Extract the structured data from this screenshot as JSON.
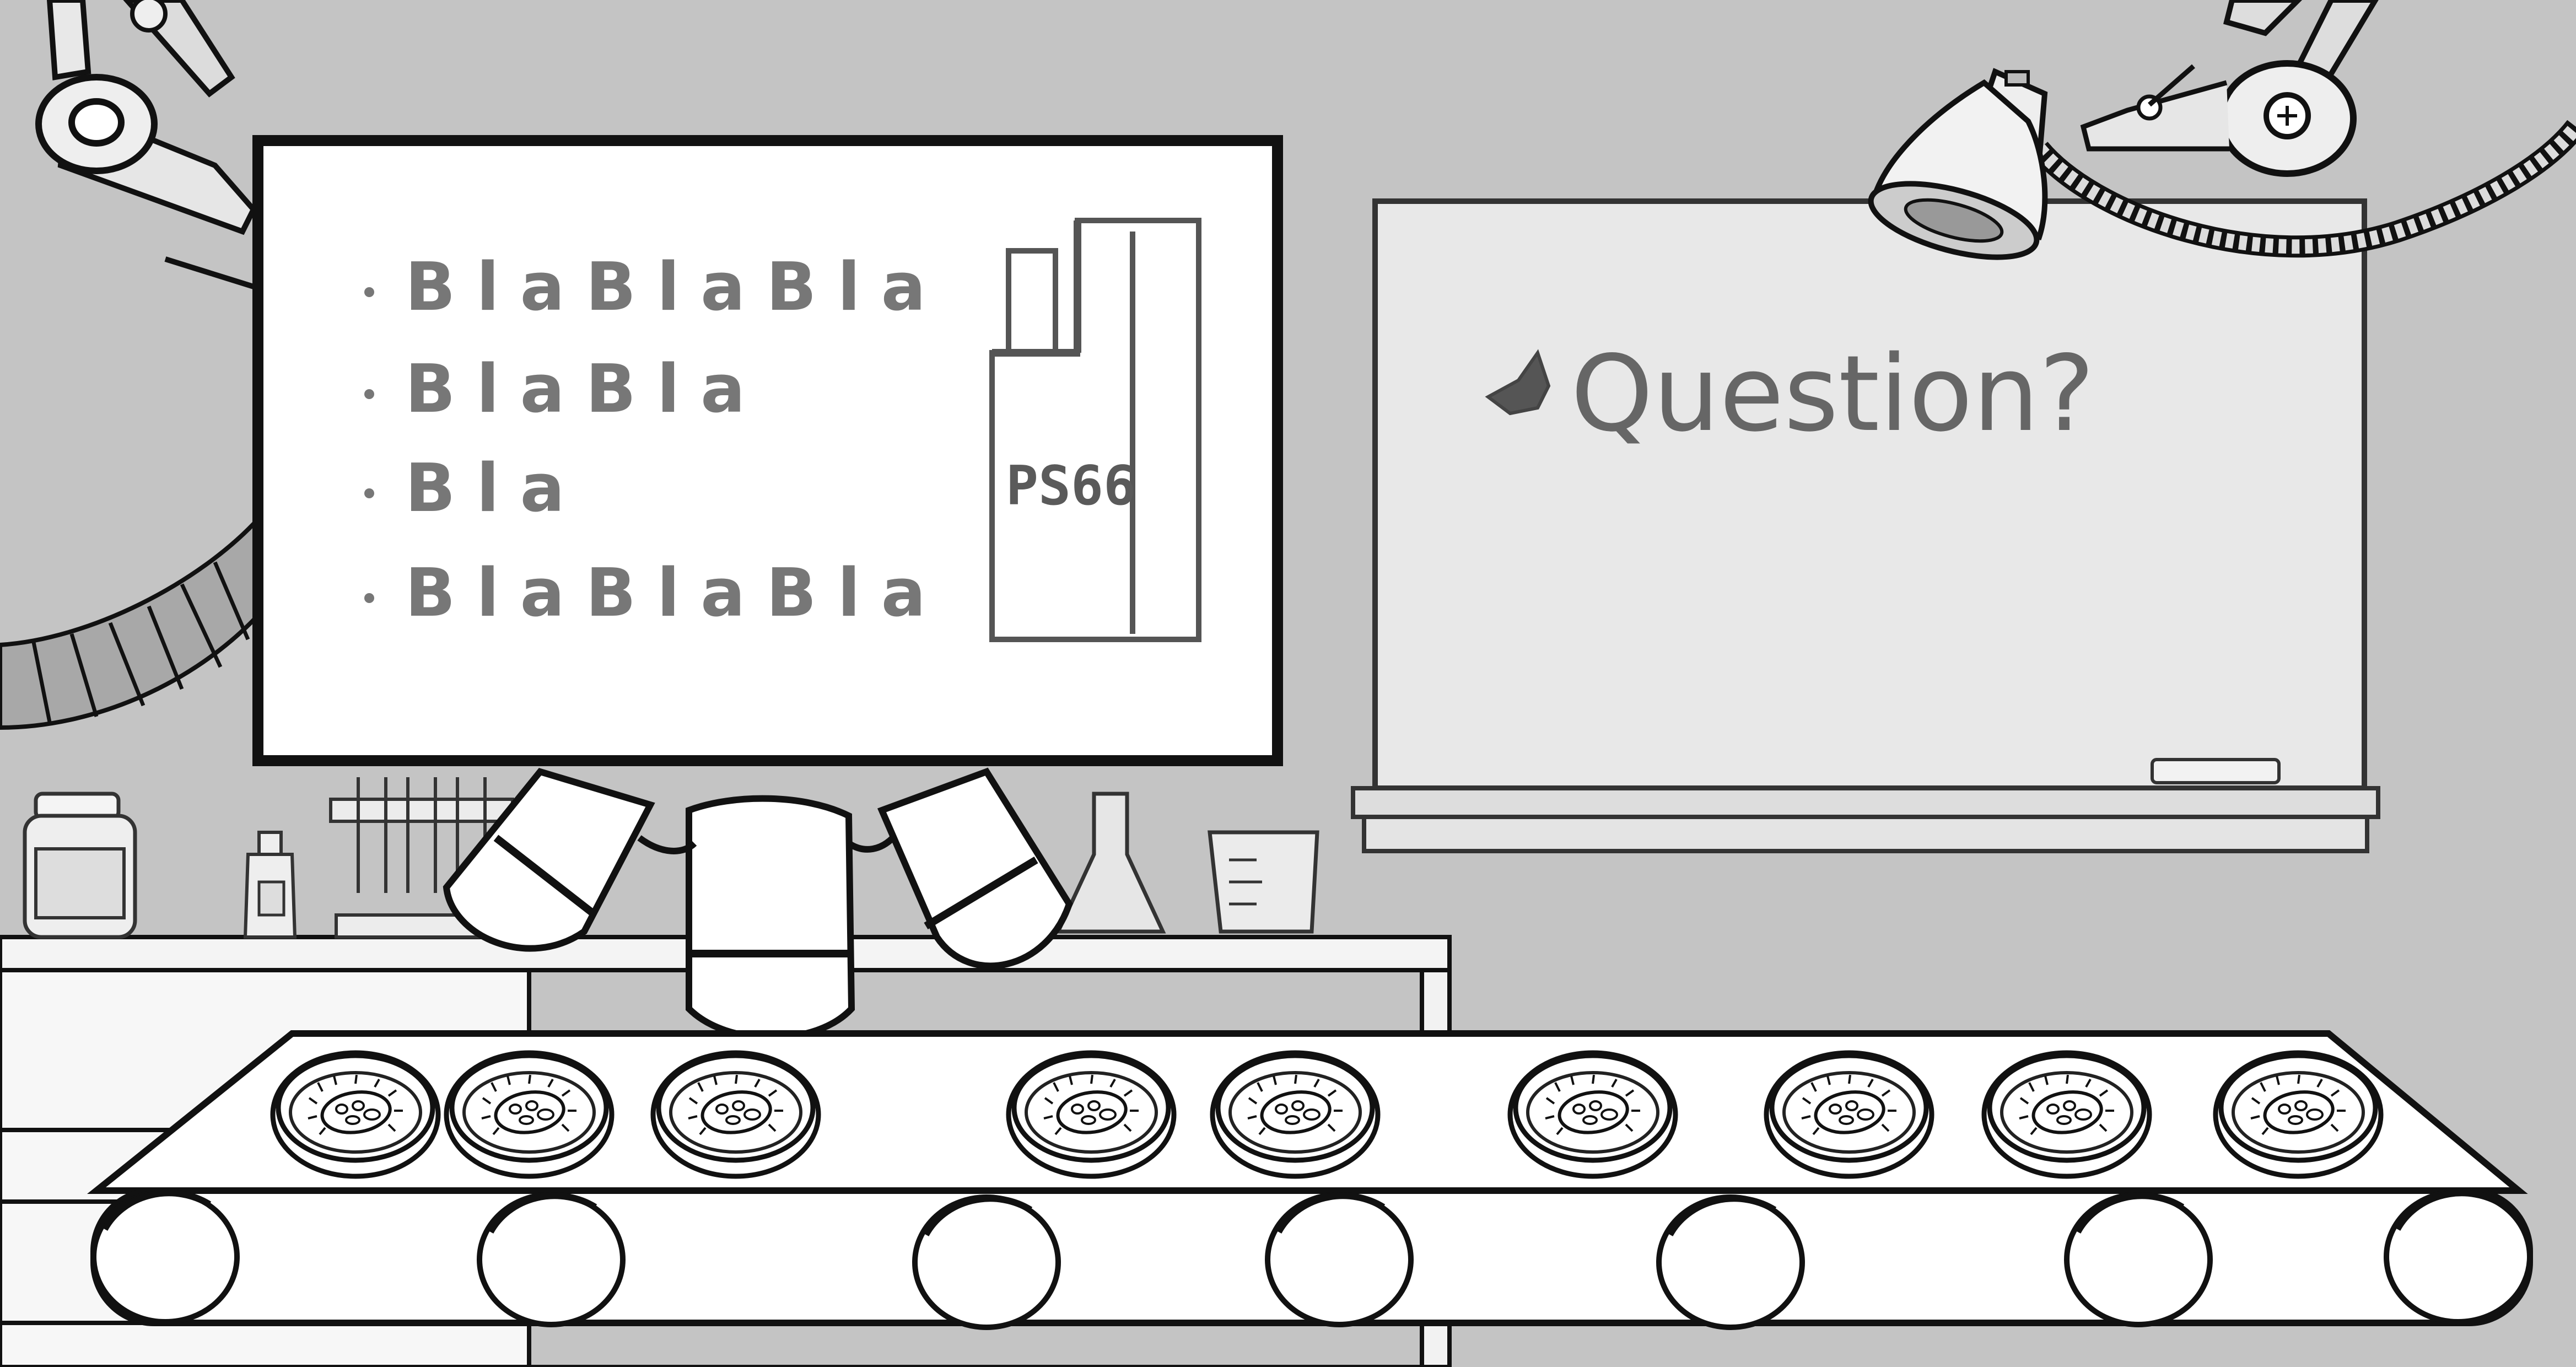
{
  "screen": {
    "bullets": [
      "BlaBlaBla",
      "BlaBla",
      "Bla",
      "BlaBlaBla"
    ],
    "book_label": "PS66"
  },
  "whiteboard": {
    "text": "Question?"
  }
}
